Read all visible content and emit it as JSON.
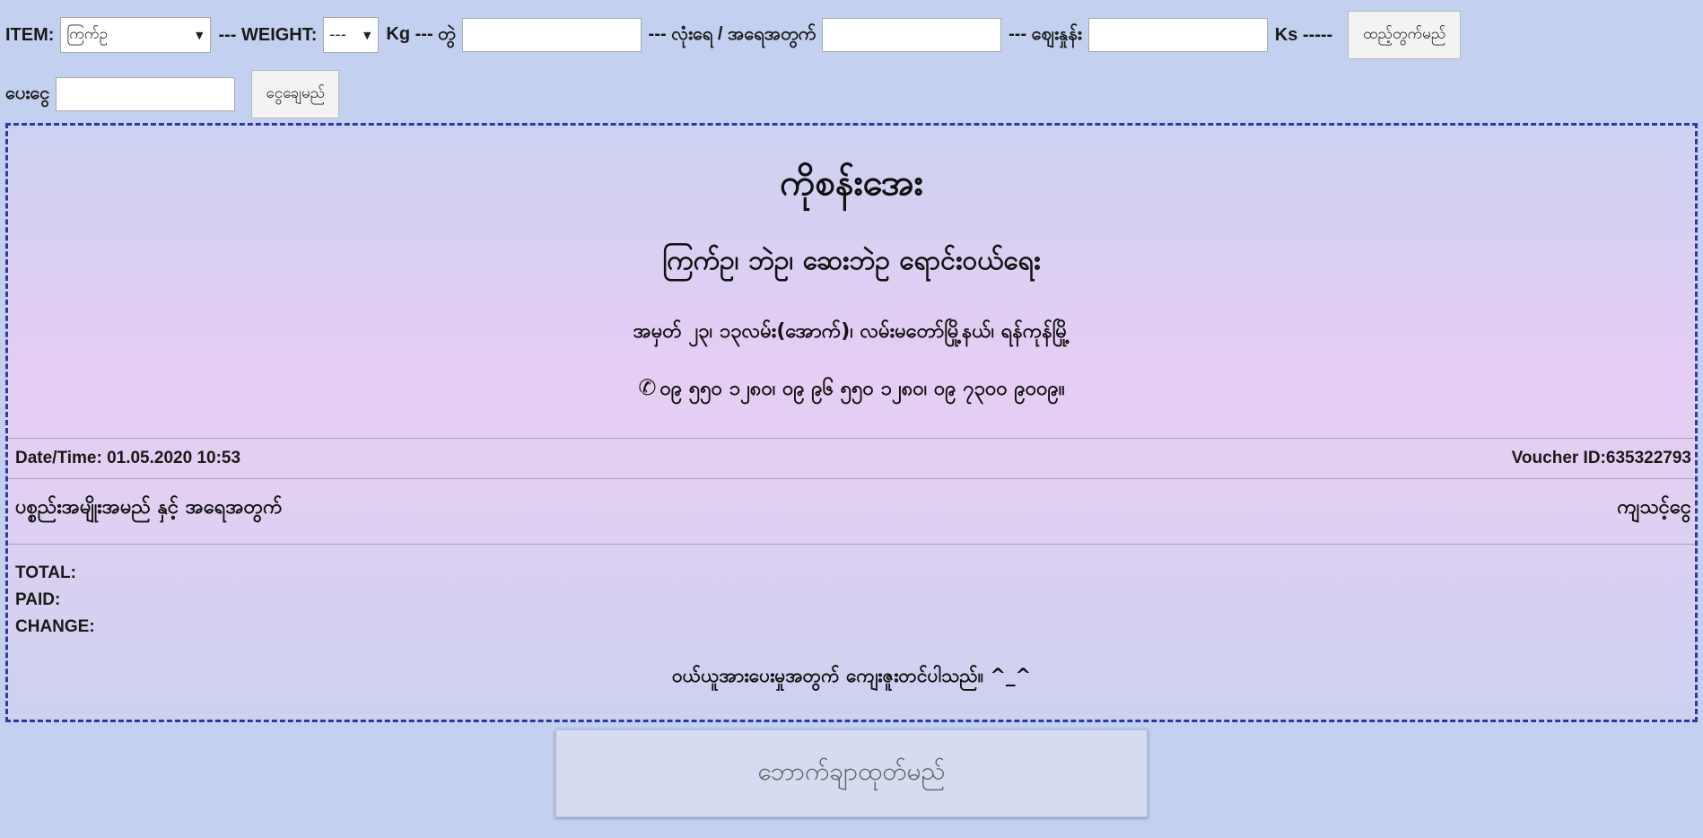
{
  "form": {
    "item_label": "ITEM:",
    "item_selected": "ကြက်ဥ",
    "weight_label": "--- WEIGHT:",
    "weight_selected": "---",
    "kg_label": "Kg --- တွဲ",
    "qty_label": "--- လုံးရေ / အရေအတွက်",
    "price_label": "--- စျေးနှုန်း",
    "ks_label": "Ks -----",
    "add_button": "ထည့်တွက်မည်",
    "pay_label": "ပေးငွေ",
    "pay_button": "ငွေချေမည်"
  },
  "receipt": {
    "shop_name": "ကိုစန်းအေး",
    "business": "ကြက်ဥ၊ ဘဲဥ၊ ဆေးဘဲဥ ရောင်းဝယ်ရေး",
    "address": "အမှတ် ၂၃၊ ၁၃လမ်း(အောက်)၊ လမ်းမတော်မြို့နယ်၊ ရန်ကုန်မြို့",
    "phone_icon": "phone-icon",
    "phones": "၀၉ ၅၅၀ ၁၂၈၀၊ ၀၉ ၉၆ ၅၅၀ ၁၂၈၀၊ ၀၉ ၇၃၀၀ ၉၀၀၉။",
    "datetime": "Date/Time: 01.05.2020 10:53",
    "voucher_id": "Voucher ID:635322793",
    "col_items": "ပစ္စည်းအမျိုးအမည် နှင့် အရေအတွက်",
    "col_amount": "ကျသင့်ငွေ",
    "total_label": "TOTAL:",
    "paid_label": "PAID:",
    "change_label": "CHANGE:",
    "thanks": "ဝယ်ယူအားပေးမှုအတွက် ကျေးဇူးတင်ပါသည်။ ^_^"
  },
  "print_button": "ဘောက်ချာထုတ်မည်"
}
